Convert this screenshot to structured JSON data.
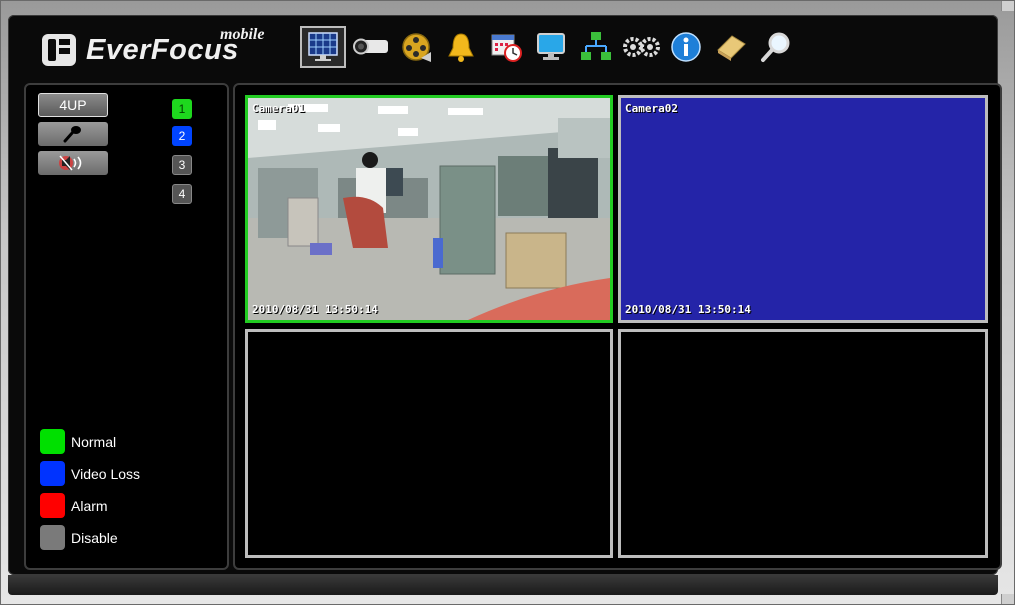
{
  "brand": {
    "name": "EverFocus",
    "sub": "mobile"
  },
  "toolbar": {
    "active": "live-view",
    "items": [
      {
        "icon": "live-view-icon"
      },
      {
        "icon": "camera-icon"
      },
      {
        "icon": "playback-reel-icon"
      },
      {
        "icon": "alarm-bell-icon"
      },
      {
        "icon": "schedule-calendar-icon"
      },
      {
        "icon": "monitor-icon"
      },
      {
        "icon": "network-icon"
      },
      {
        "icon": "settings-gears-icon"
      },
      {
        "icon": "info-icon"
      },
      {
        "icon": "log-book-icon"
      },
      {
        "icon": "search-icon"
      }
    ]
  },
  "controls": {
    "layout_label": "4UP",
    "mic_icon": "microphone-icon",
    "speaker_icon": "speaker-muted-icon"
  },
  "channels": [
    {
      "label": "1",
      "status": "Normal"
    },
    {
      "label": "2",
      "status": "Video Loss"
    },
    {
      "label": "3",
      "status": "Disable"
    },
    {
      "label": "4",
      "status": "Disable"
    }
  ],
  "legend": [
    {
      "label": "Normal",
      "color": "#00e000"
    },
    {
      "label": "Video Loss",
      "color": "#0033ff"
    },
    {
      "label": "Alarm",
      "color": "#ff0000"
    },
    {
      "label": "Disable",
      "color": "#7a7a7a"
    }
  ],
  "cameras": [
    {
      "name": "Camera01",
      "timestamp": "2010/08/31  13:50:14",
      "state": "live",
      "border": "#22cc22"
    },
    {
      "name": "Camera02",
      "timestamp": "2010/08/31  13:50:14",
      "state": "video-loss",
      "fill": "#2424a8",
      "border": "#bdbdbd"
    },
    {
      "name": "",
      "timestamp": "",
      "state": "empty",
      "border": "#bdbdbd"
    },
    {
      "name": "",
      "timestamp": "",
      "state": "empty",
      "border": "#bdbdbd"
    }
  ]
}
